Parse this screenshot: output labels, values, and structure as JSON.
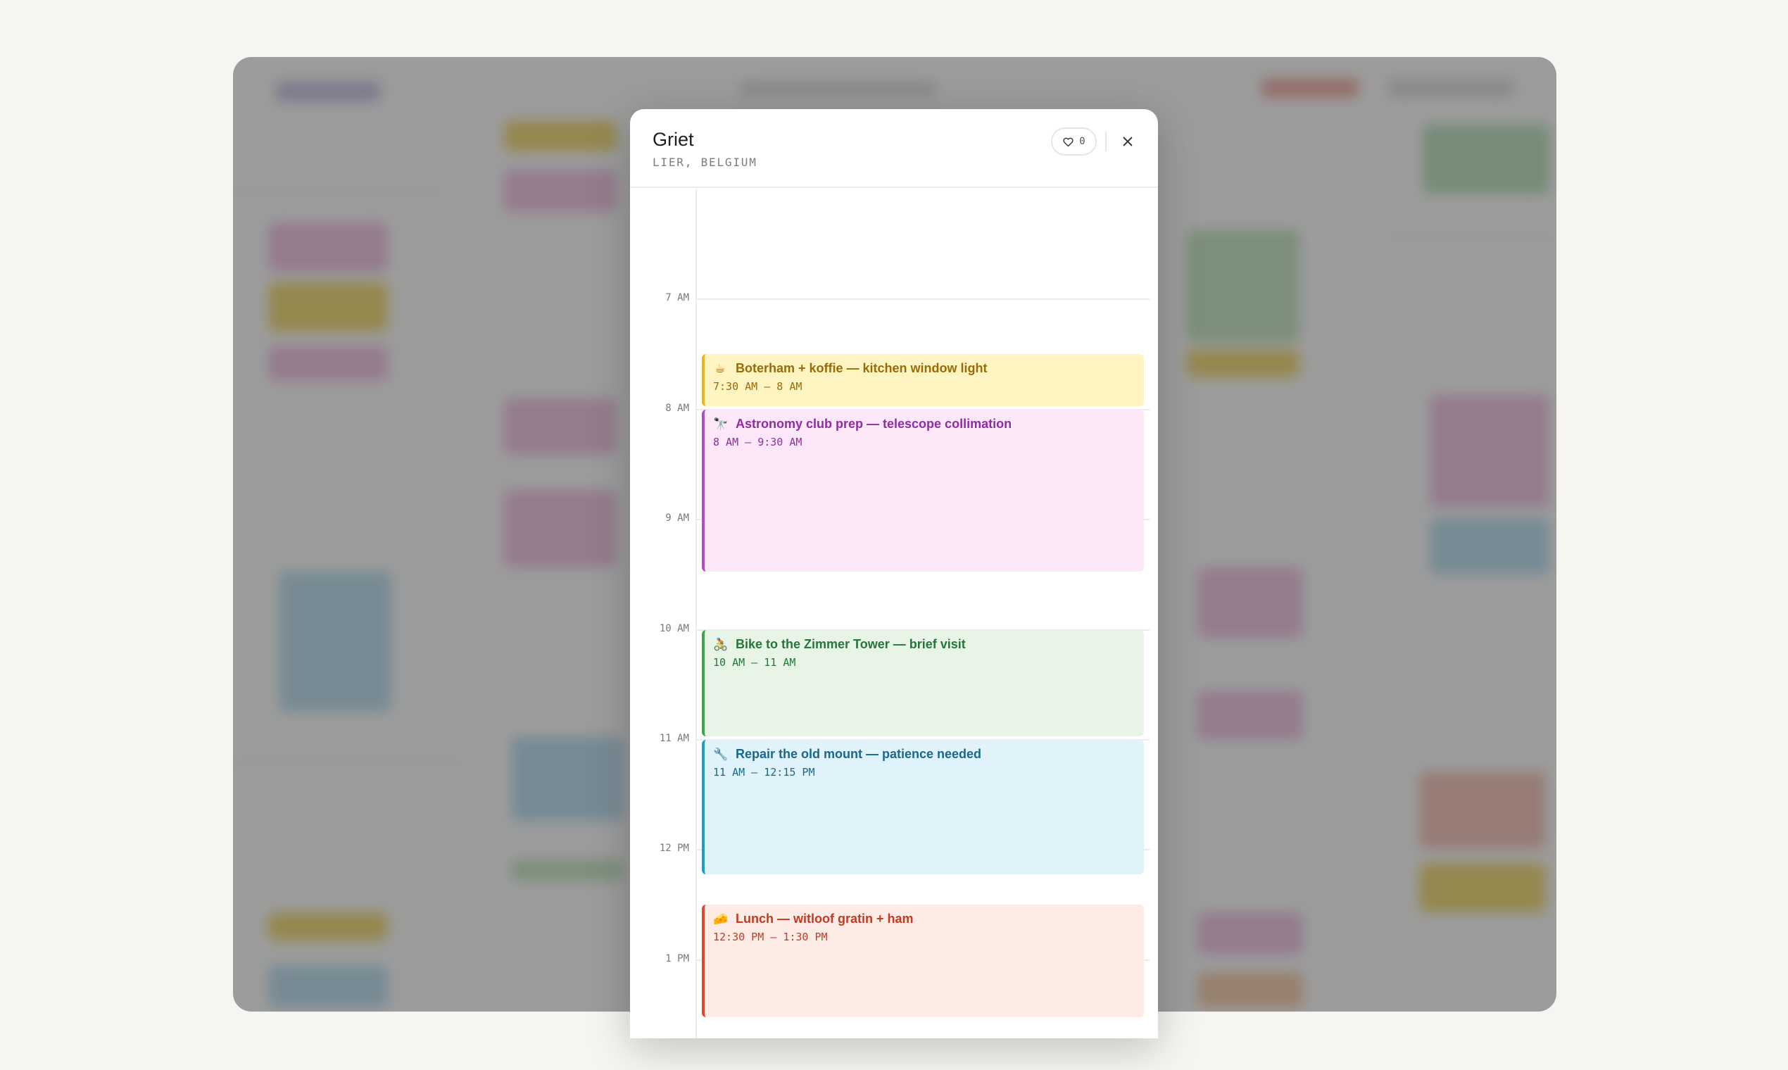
{
  "modal": {
    "title": "Griet",
    "subtitle": "LIER, BELGIUM",
    "like_count": "0"
  },
  "timeline": {
    "hours": [
      {
        "label": "7 AM"
      },
      {
        "label": "8 AM"
      },
      {
        "label": "9 AM"
      },
      {
        "label": "10 AM"
      },
      {
        "label": "11 AM"
      },
      {
        "label": "12 PM"
      },
      {
        "label": "1 PM"
      }
    ],
    "events": [
      {
        "icon": "☕",
        "icon_name": "coffee-icon",
        "title": "Boterham + koffie — kitchen window light",
        "time": "7:30 AM – 8 AM",
        "accent": "#e8b51f",
        "background": "#fff5c2",
        "text_color": "#9a6a07"
      },
      {
        "icon": "🔭",
        "icon_name": "telescope-icon",
        "title": "Astronomy club prep — telescope collimation",
        "time": "8 AM – 9:30 AM",
        "accent": "#b349c9",
        "background": "#fce8f8",
        "text_color": "#8e2ca5"
      },
      {
        "icon": "🚴",
        "icon_name": "bicycle-icon",
        "title": "Bike to the Zimmer Tower — brief visit",
        "time": "10 AM – 11 AM",
        "accent": "#3aa54c",
        "background": "#e8f5e6",
        "text_color": "#24763a"
      },
      {
        "icon": "🔧",
        "icon_name": "wrench-icon",
        "title": "Repair the old mount — patience needed",
        "time": "11 AM – 12:15 PM",
        "accent": "#1e9bc8",
        "background": "#e0f2fa",
        "text_color": "#17688c"
      },
      {
        "icon": "🧀",
        "icon_name": "cheese-icon",
        "title": "Lunch — witloof gratin + ham",
        "time": "12:30 PM – 1:30 PM",
        "accent": "#e2452e",
        "background": "#fdece6",
        "text_color": "#c23a22"
      }
    ]
  }
}
